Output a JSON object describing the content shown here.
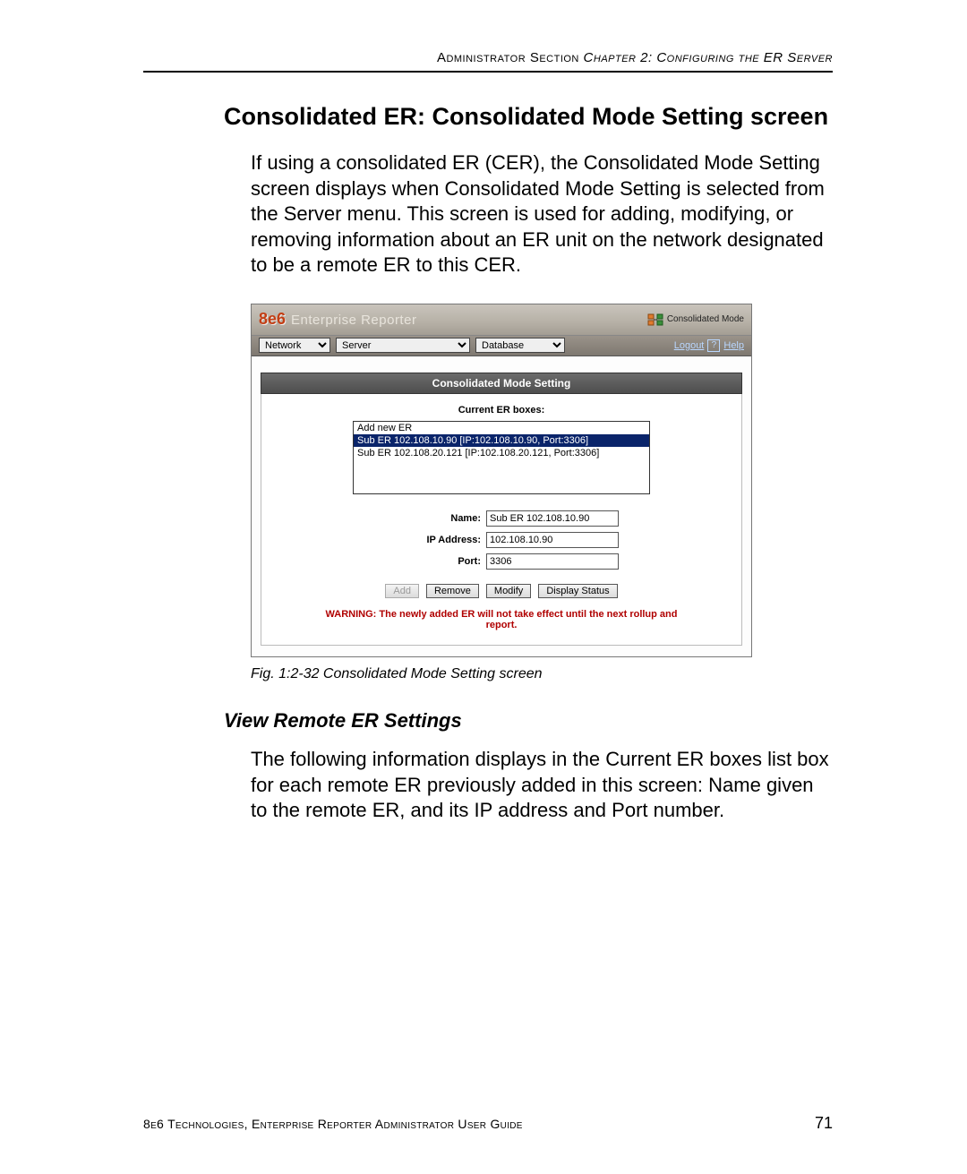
{
  "running_head": {
    "section": "Administrator Section ",
    "chapter": "Chapter 2: Configuring the ER Server"
  },
  "section_title": "Consolidated ER: Consolidated Mode Setting screen",
  "intro_paragraph": "If using a consolidated ER (CER), the Consolidated Mode Setting screen displays when Consolidated Mode Setting is selected from the Server menu. This screen is used for adding, modifying, or removing information about an ER unit on the network designated to be a remote ER to this CER.",
  "app": {
    "brand_prefix": "8e6",
    "brand_name": "Enterprise Reporter",
    "mode_label": "Consolidated Mode",
    "menus": {
      "network": "Network",
      "server": "Server",
      "database": "Database"
    },
    "links": {
      "logout": "Logout",
      "help": "Help"
    },
    "panel_title": "Consolidated Mode Setting",
    "list_heading": "Current ER boxes:",
    "list_items": [
      "Add new ER",
      "Sub ER 102.108.10.90 [IP:102.108.10.90, Port:3306]",
      "Sub ER 102.108.20.121 [IP:102.108.20.121, Port:3306]"
    ],
    "list_selected_index": 1,
    "fields": {
      "name_label": "Name:",
      "name_value": "Sub ER 102.108.10.90",
      "ip_label": "IP Address:",
      "ip_value": "102.108.10.90",
      "port_label": "Port:",
      "port_value": "3306"
    },
    "buttons": {
      "add": "Add",
      "remove": "Remove",
      "modify": "Modify",
      "display_status": "Display Status"
    },
    "warning": "WARNING: The newly added ER will not take effect until the next rollup and report."
  },
  "figure_caption": "Fig. 1:2-32  Consolidated Mode Setting screen",
  "subsection_title": "View Remote ER Settings",
  "subsection_paragraph": "The following information displays in the Current ER boxes list box for each remote ER previously added in this screen: Name given to the remote ER, and its IP address and Port number.",
  "footer": {
    "guide": "8e6 Technologies, Enterprise Reporter Administrator User Guide",
    "page": "71"
  }
}
